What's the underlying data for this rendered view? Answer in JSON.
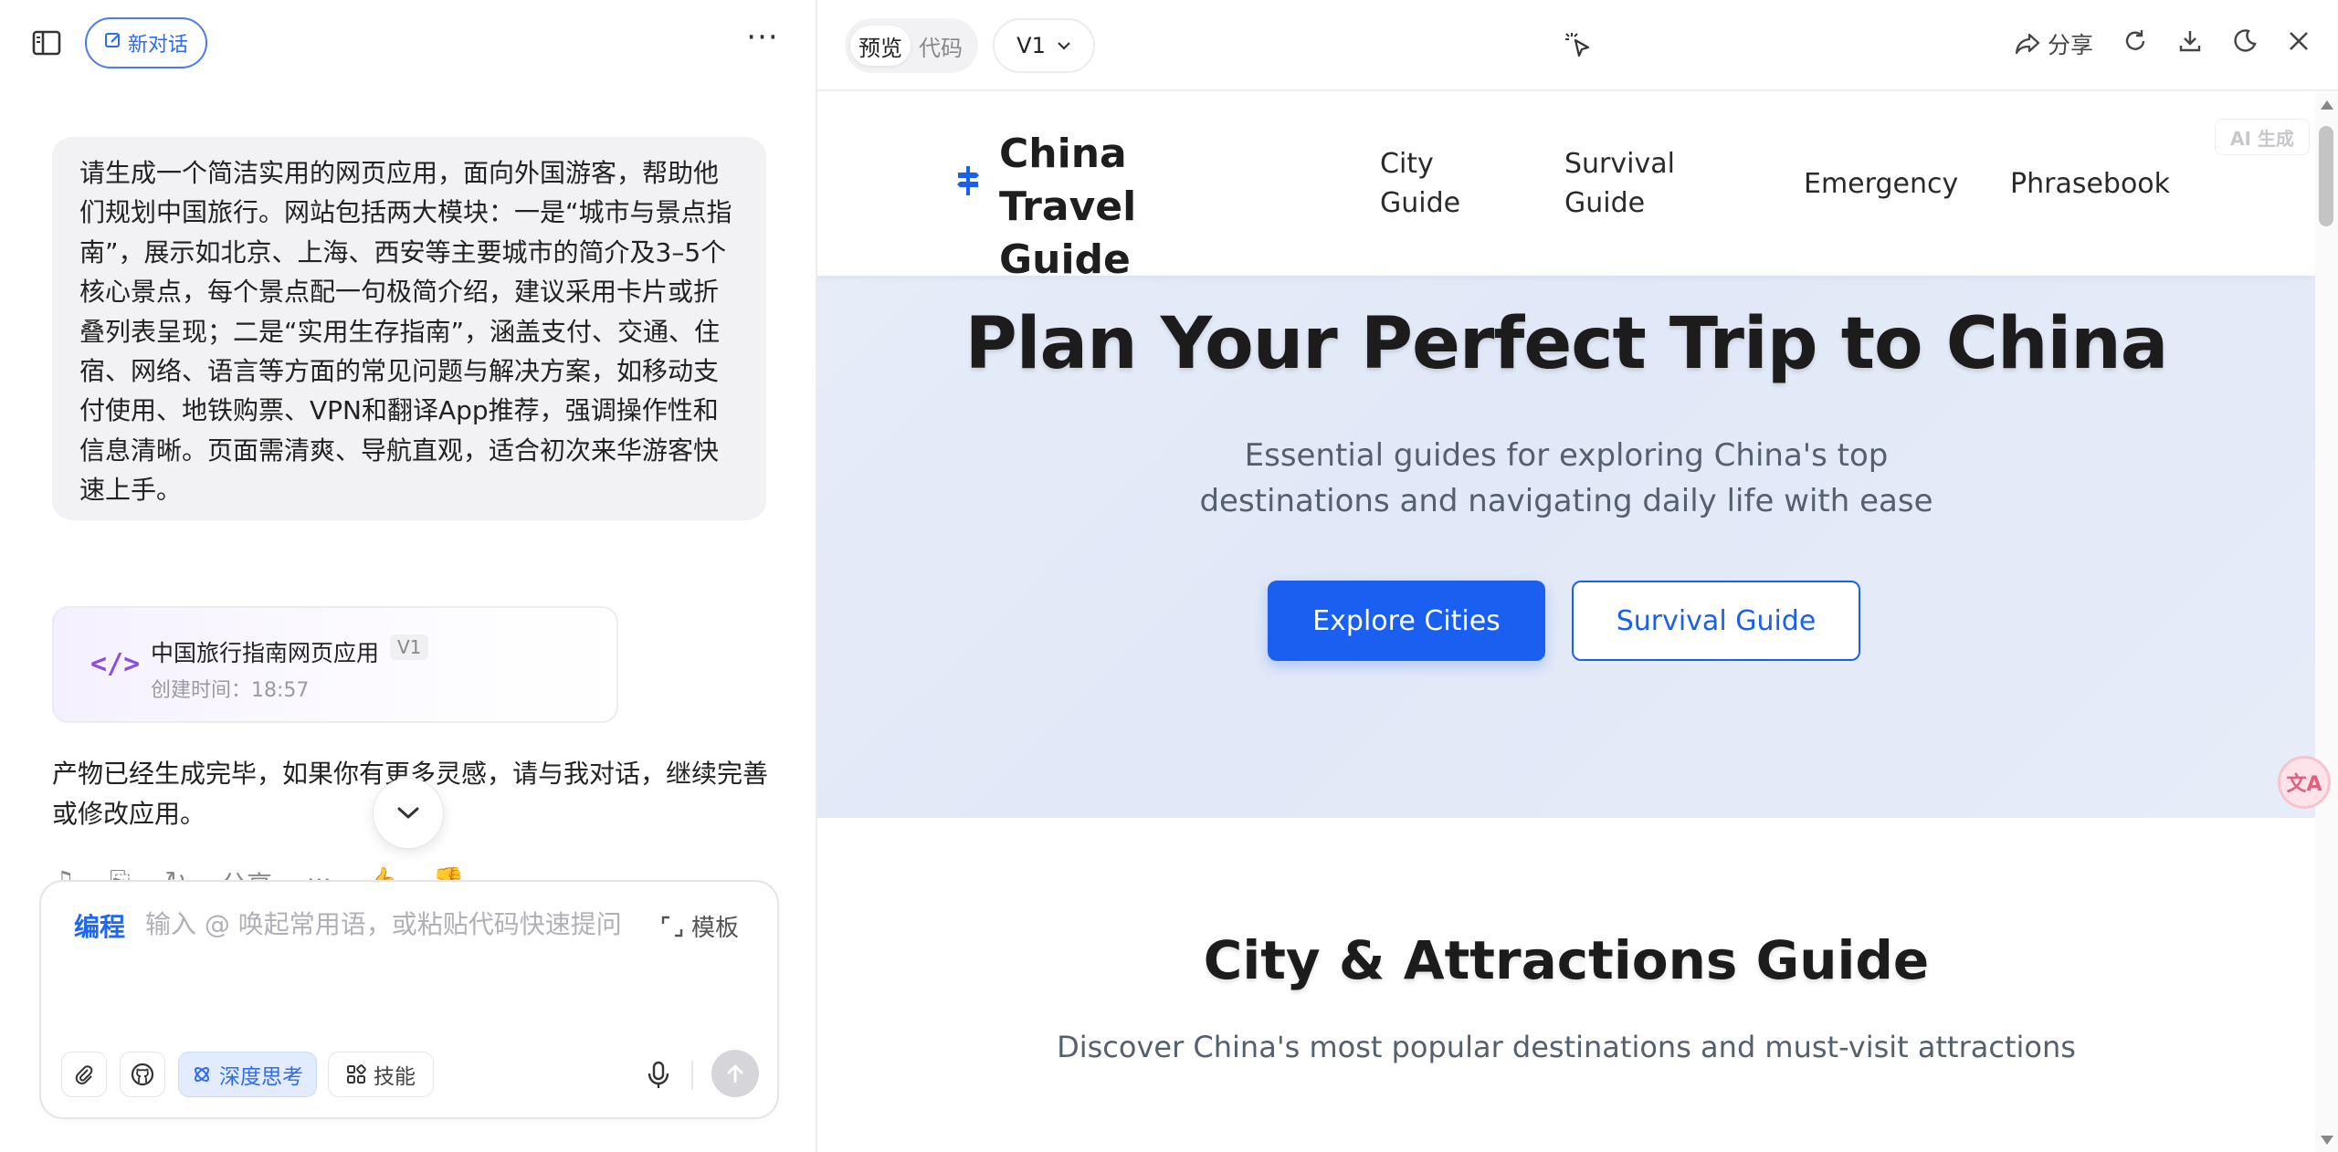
{
  "chat": {
    "new_chat_label": "新对话",
    "more_label": "···",
    "user_message": "请生成一个简洁实用的网页应用，面向外国游客，帮助他们规划中国旅行。网站包括两大模块：一是“城市与景点指南”，展示如北京、上海、西安等主要城市的简介及3–5个核心景点，每个景点配一句极简介绍，建议采用卡片或折叠列表呈现；二是“实用生存指南”，涵盖支付、交通、住宿、网络、语言等方面的常见问题与解决方案，如移动支付使用、地铁购票、VPN和翻译App推荐，强调操作性和信息清晰。页面需清爽、导航直观，适合初次来华游客快速上手。",
    "artifact": {
      "title": "中国旅行指南网页应用",
      "version": "V1",
      "created": "创建时间：18:57"
    },
    "assistant_message": "产物已经生成完毕，如果你有更多灵感，请与我对话，继续完善或修改应用。",
    "actions": [
      "♫",
      "⎘",
      "↻",
      "分享",
      "···",
      "👍",
      "👎"
    ]
  },
  "composer": {
    "mode_tag": "编程",
    "placeholder": "输入 @ 唤起常用语，或粘贴代码快速提问",
    "template_label": "模板",
    "deep_think_label": "深度思考",
    "skills_label": "技能"
  },
  "preview_toolbar": {
    "tab_preview": "预览",
    "tab_code": "代码",
    "version": "V1",
    "share_label": "分享"
  },
  "site": {
    "logo_text": "China Travel Guide",
    "nav": {
      "city": "City Guide",
      "survival": "Survival Guide",
      "emergency": "Emergency",
      "phrasebook": "Phrasebook"
    },
    "ai_badge": "AI 生成",
    "hero": {
      "title": "Plan Your Perfect Trip to China",
      "subtitle": "Essential guides for exploring China's top destinations and navigating daily life with ease",
      "btn_explore": "Explore Cities",
      "btn_survival": "Survival Guide"
    },
    "section": {
      "title": "City & Attractions Guide",
      "subtitle": "Discover China's most popular destinations and must-visit attractions"
    }
  },
  "fab": {
    "translate": "文A"
  },
  "colors": {
    "accent": "#1a5ff0",
    "brand_purple": "#8a4fe0",
    "hero_bg": "#e3e9f7"
  }
}
